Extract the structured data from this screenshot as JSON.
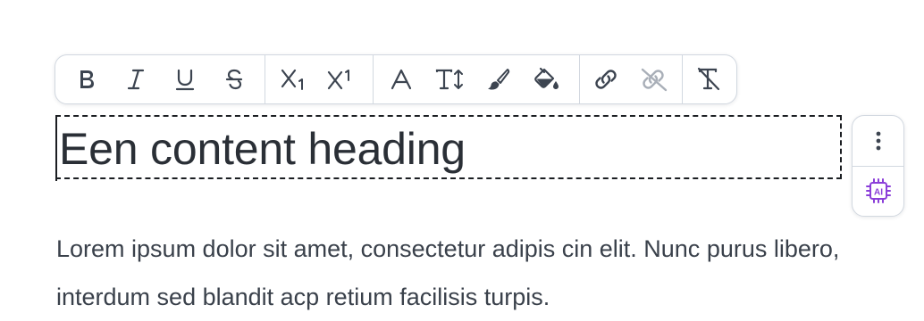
{
  "toolbar": {
    "groups": [
      {
        "name": "text-style",
        "buttons": [
          {
            "icon": "bold-icon",
            "label": "B"
          },
          {
            "icon": "italic-icon",
            "label": "I"
          },
          {
            "icon": "underline-icon",
            "label": "U"
          },
          {
            "icon": "strikethrough-icon",
            "label": "S"
          }
        ]
      },
      {
        "name": "script",
        "buttons": [
          {
            "icon": "subscript-icon",
            "label": "X₁"
          },
          {
            "icon": "superscript-icon",
            "label": "X¹"
          }
        ]
      },
      {
        "name": "font",
        "buttons": [
          {
            "icon": "font-icon",
            "label": "A"
          },
          {
            "icon": "font-size-icon",
            "label": "T↕"
          },
          {
            "icon": "paint-brush-icon"
          },
          {
            "icon": "fill-color-icon"
          }
        ]
      },
      {
        "name": "link",
        "buttons": [
          {
            "icon": "link-icon"
          },
          {
            "icon": "unlink-icon",
            "disabled": true
          }
        ]
      },
      {
        "name": "clear",
        "buttons": [
          {
            "icon": "clear-format-icon"
          }
        ]
      }
    ]
  },
  "heading": {
    "text": "Een content heading"
  },
  "side_actions": {
    "more_icon": "vertical-dots-icon",
    "ai_icon": "ai-chip-icon",
    "ai_label": "AI",
    "ai_color": "#8b3fd9"
  },
  "paragraph": {
    "text": "Lorem ipsum dolor sit amet, consectetur adipis cin elit. Nunc purus libero, interdum sed blandit acp retium facilisis turpis."
  },
  "colors": {
    "icon": "#3c4450",
    "icon_disabled": "#a9afb8",
    "border": "#d2d8e0",
    "heading_text": "#2a2f36",
    "body_text": "#3a414b",
    "ai_accent": "#8b3fd9"
  }
}
